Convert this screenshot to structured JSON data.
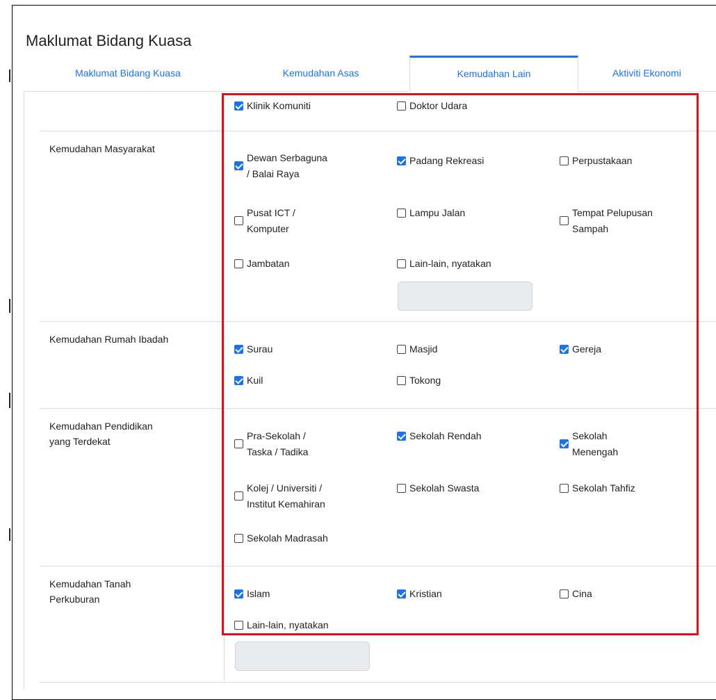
{
  "page_title": "Maklumat Bidang Kuasa",
  "tabs": [
    {
      "label": "Maklumat Bidang Kuasa"
    },
    {
      "label": "Kemudahan Asas"
    },
    {
      "label": "Kemudahan Lain",
      "active": true
    },
    {
      "label": "Aktiviti Ekonomi"
    }
  ],
  "sections": [
    {
      "label": "",
      "options": [
        {
          "label": "Klinik Komuniti",
          "checked": true
        },
        {
          "label": "Doktor Udara",
          "checked": false
        }
      ]
    },
    {
      "label": "Kemudahan Masyarakat",
      "options": [
        {
          "line1": "Dewan Serbaguna",
          "line2": "/ Balai Raya",
          "checked": true
        },
        {
          "label": "Padang Rekreasi",
          "checked": true
        },
        {
          "label": "Perpustakaan",
          "checked": false
        },
        {
          "line1": "Pusat ICT /",
          "line2": "Komputer",
          "checked": false
        },
        {
          "label": "Lampu Jalan",
          "checked": false
        },
        {
          "line1": "Tempat Pelupusan",
          "line2": "Sampah",
          "checked": false
        },
        {
          "label": "Jambatan",
          "checked": false
        },
        {
          "label": "Lain-lain, nyatakan",
          "checked": false
        }
      ],
      "other_input_value": ""
    },
    {
      "label": "Kemudahan Rumah Ibadah",
      "options": [
        {
          "label": "Surau",
          "checked": true
        },
        {
          "label": "Masjid",
          "checked": false
        },
        {
          "label": "Gereja",
          "checked": true
        },
        {
          "label": "Kuil",
          "checked": true
        },
        {
          "label": "Tokong",
          "checked": false
        }
      ]
    },
    {
      "label_line1": "Kemudahan Pendidikan",
      "label_line2": "yang Terdekat",
      "options": [
        {
          "line1": "Pra-Sekolah /",
          "line2": "Taska / Tadika",
          "checked": false
        },
        {
          "label": "Sekolah Rendah",
          "checked": true
        },
        {
          "line1": "Sekolah",
          "line2": "Menengah",
          "checked": true
        },
        {
          "line1": "Kolej / Universiti /",
          "line2": "Institut Kemahiran",
          "checked": false
        },
        {
          "label": "Sekolah Swasta",
          "checked": false
        },
        {
          "label": "Sekolah Tahfiz",
          "checked": false
        },
        {
          "label": "Sekolah Madrasah",
          "checked": false
        }
      ]
    },
    {
      "label_line1": "Kemudahan Tanah",
      "label_line2": "Perkuburan",
      "options": [
        {
          "label": "Islam",
          "checked": true
        },
        {
          "label": "Kristian",
          "checked": true
        },
        {
          "label": "Cina",
          "checked": false
        },
        {
          "label": "Lain-lain, nyatakan",
          "checked": false
        }
      ],
      "other_input_value": ""
    }
  ],
  "colors": {
    "accent": "#1a73e8",
    "highlight_border": "#e0101a",
    "input_bg": "#e9ecef",
    "divider": "#dcdcdc"
  }
}
